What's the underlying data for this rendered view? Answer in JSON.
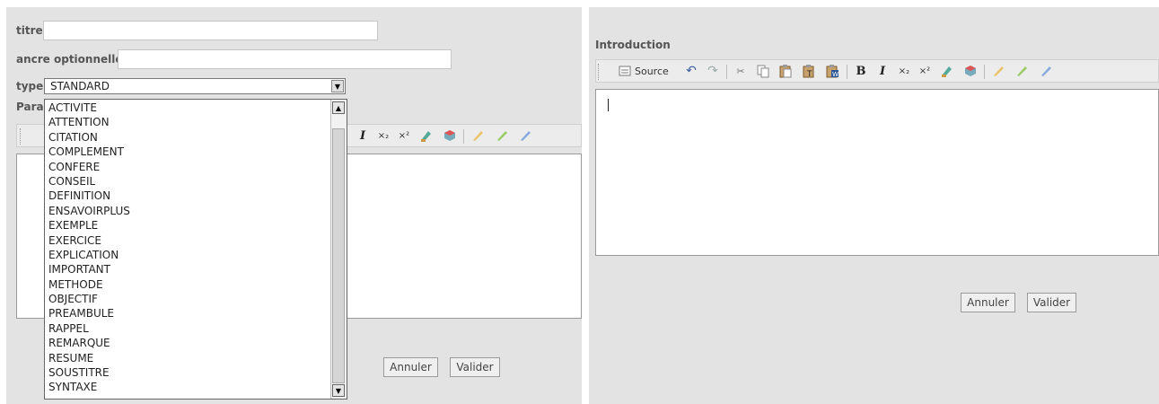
{
  "left_form": {
    "title_label": "titre",
    "title_value": "",
    "anchor_label": "ancre optionnelle",
    "anchor_value": "",
    "type_label": "type",
    "type_value": "STANDARD",
    "paragraph_label_partial": "Para",
    "type_options": [
      "ACTIVITE",
      "ATTENTION",
      "CITATION",
      "COMPLEMENT",
      "CONFERE",
      "CONSEIL",
      "DEFINITION",
      "ENSAVOIRPLUS",
      "EXEMPLE",
      "EXERCICE",
      "EXPLICATION",
      "IMPORTANT",
      "METHODE",
      "OBJECTIF",
      "PREAMBULE",
      "RAPPEL",
      "REMARQUE",
      "RESUME",
      "SOUSTITRE",
      "SYNTAXE"
    ],
    "cancel_label": "Annuler",
    "submit_label": "Valider"
  },
  "right_form": {
    "section_label": "Introduction",
    "source_label": "Source",
    "cancel_label": "Annuler",
    "submit_label": "Valider"
  },
  "toolbar_icons": {
    "bold": "B",
    "italic": "I",
    "subscript": "×₂",
    "superscript": "×²",
    "undo": "↶",
    "redo": "↷",
    "cut": "✂"
  }
}
